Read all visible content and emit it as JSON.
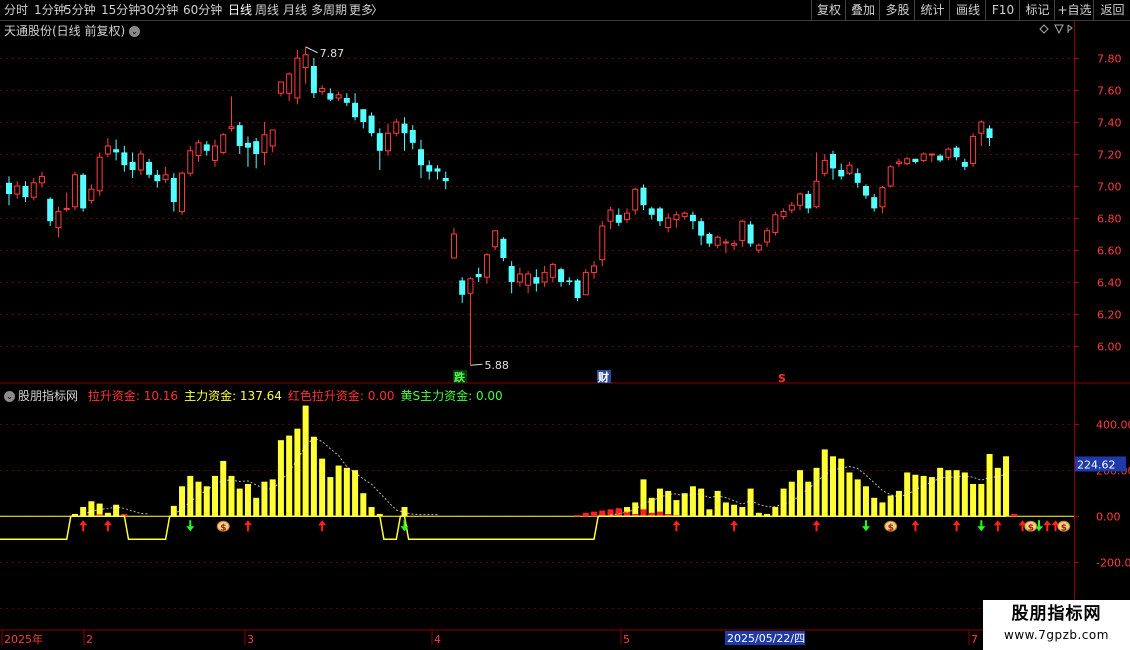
{
  "toolbar": {
    "left": [
      "分时",
      "1分钟",
      "5分钟",
      "15分钟",
      "30分钟",
      "60分钟",
      "日线",
      "周线",
      "月线",
      "多周期",
      "更多"
    ],
    "more_arrow": "〉",
    "right": [
      "复权",
      "叠加",
      "多股",
      "统计",
      "画线",
      "F10",
      "标记",
      "+自选",
      "返回"
    ]
  },
  "stock_title": "天通股份(日线 前复权)",
  "indicator": {
    "name": "股朋指标网",
    "items": [
      {
        "label": "拉升资金:",
        "value": "10.16",
        "color": "#ff3030"
      },
      {
        "label": "主力资金:",
        "value": "137.64",
        "color": "#ffff40"
      },
      {
        "label": "红色拉升资金:",
        "value": "0.00",
        "color": "#ff3030"
      },
      {
        "label": "黄S主力资金:",
        "value": "0.00",
        "color": "#40ff40"
      }
    ]
  },
  "price_axis": [
    "7.80",
    "7.60",
    "7.40",
    "7.20",
    "7.00",
    "6.80",
    "6.60",
    "6.40",
    "6.20",
    "6.00"
  ],
  "indicator_axis": [
    "400.00",
    "200.00",
    "0.00",
    "-200.0",
    "-400.0"
  ],
  "indicator_current": "224.62",
  "price_annotations": {
    "high": "7.87",
    "low": "5.88"
  },
  "markers": {
    "die": "跌",
    "cai": "财",
    "s": "S"
  },
  "date_axis": [
    "2025年",
    "2",
    "3",
    "4",
    "5",
    "6",
    "7"
  ],
  "date_cursor": "2025/05/22/四",
  "watermark": {
    "title": "股朋指标网",
    "url": "www.7gpzb.com"
  },
  "colors": {
    "up": "#ff3c3c",
    "down": "#54ffff",
    "background": "#000000",
    "volume": "#ffff33",
    "grid": "#8b0000"
  },
  "chart_data": {
    "type": "candlestick",
    "ylim": [
      5.85,
      7.95
    ],
    "candles": [
      [
        7.02,
        6.95,
        7.06,
        6.88
      ],
      [
        6.95,
        7.0,
        7.03,
        6.92
      ],
      [
        7.0,
        6.93,
        7.03,
        6.9
      ],
      [
        6.93,
        7.02,
        7.05,
        6.91
      ],
      [
        7.02,
        7.06,
        7.09,
        6.99
      ],
      [
        6.92,
        6.78,
        6.93,
        6.75
      ],
      [
        6.74,
        6.84,
        6.87,
        6.68
      ],
      [
        6.86,
        6.86,
        6.96,
        6.84
      ],
      [
        6.87,
        7.07,
        7.09,
        6.85
      ],
      [
        7.07,
        6.86,
        7.08,
        6.84
      ],
      [
        6.91,
        6.98,
        7.01,
        6.89
      ],
      [
        6.97,
        7.18,
        7.21,
        6.94
      ],
      [
        7.2,
        7.25,
        7.3,
        7.18
      ],
      [
        7.23,
        7.21,
        7.29,
        7.16
      ],
      [
        7.21,
        7.13,
        7.25,
        7.09
      ],
      [
        7.15,
        7.1,
        7.21,
        7.05
      ],
      [
        7.1,
        7.2,
        7.22,
        7.07
      ],
      [
        7.15,
        7.07,
        7.17,
        7.05
      ],
      [
        7.07,
        7.03,
        7.1,
        6.99
      ],
      [
        7.04,
        7.07,
        7.12,
        7.02
      ],
      [
        7.05,
        6.9,
        7.08,
        6.84
      ],
      [
        6.84,
        7.08,
        7.09,
        6.82
      ],
      [
        7.08,
        7.22,
        7.25,
        7.06
      ],
      [
        7.19,
        7.27,
        7.29,
        7.15
      ],
      [
        7.26,
        7.22,
        7.28,
        7.19
      ],
      [
        7.16,
        7.25,
        7.29,
        7.12
      ],
      [
        7.21,
        7.32,
        7.33,
        7.2
      ],
      [
        7.36,
        7.37,
        7.56,
        7.34
      ],
      [
        7.38,
        7.25,
        7.4,
        7.2
      ],
      [
        7.27,
        7.24,
        7.31,
        7.12
      ],
      [
        7.28,
        7.2,
        7.3,
        7.11
      ],
      [
        7.21,
        7.32,
        7.4,
        7.13
      ],
      [
        7.25,
        7.35,
        7.35,
        7.21
      ],
      [
        7.58,
        7.65,
        7.65,
        7.56
      ],
      [
        7.58,
        7.7,
        7.71,
        7.53
      ],
      [
        7.55,
        7.8,
        7.85,
        7.51
      ],
      [
        7.74,
        7.82,
        7.87,
        7.64
      ],
      [
        7.75,
        7.58,
        7.8,
        7.55
      ],
      [
        7.59,
        7.61,
        7.63,
        7.57
      ],
      [
        7.58,
        7.54,
        7.61,
        7.53
      ],
      [
        7.55,
        7.57,
        7.59,
        7.53
      ],
      [
        7.55,
        7.52,
        7.58,
        7.5
      ],
      [
        7.52,
        7.43,
        7.58,
        7.41
      ],
      [
        7.48,
        7.4,
        7.47,
        7.36
      ],
      [
        7.44,
        7.33,
        7.46,
        7.31
      ],
      [
        7.33,
        7.22,
        7.36,
        7.1
      ],
      [
        7.22,
        7.33,
        7.39,
        7.19
      ],
      [
        7.33,
        7.4,
        7.42,
        7.31
      ],
      [
        7.39,
        7.33,
        7.43,
        7.22
      ],
      [
        7.35,
        7.27,
        7.38,
        7.23
      ],
      [
        7.23,
        7.13,
        7.29,
        7.05
      ],
      [
        7.13,
        7.09,
        7.16,
        7.04
      ],
      [
        7.11,
        7.09,
        7.13,
        7.04
      ],
      [
        7.05,
        7.03,
        7.09,
        6.98
      ],
      [
        6.55,
        6.7,
        6.74,
        6.55
      ],
      [
        6.41,
        6.32,
        6.43,
        6.27
      ],
      [
        6.33,
        6.42,
        6.43,
        5.88
      ],
      [
        6.45,
        6.43,
        6.49,
        6.4
      ],
      [
        6.43,
        6.57,
        6.58,
        6.39
      ],
      [
        6.62,
        6.72,
        6.72,
        6.6
      ],
      [
        6.67,
        6.55,
        6.68,
        6.53
      ],
      [
        6.5,
        6.4,
        6.53,
        6.33
      ],
      [
        6.4,
        6.45,
        6.49,
        6.37
      ],
      [
        6.38,
        6.45,
        6.47,
        6.33
      ],
      [
        6.43,
        6.39,
        6.48,
        6.34
      ],
      [
        6.4,
        6.46,
        6.5,
        6.37
      ],
      [
        6.43,
        6.51,
        6.52,
        6.4
      ],
      [
        6.48,
        6.4,
        6.49,
        6.37
      ],
      [
        6.41,
        6.4,
        6.43,
        6.38
      ],
      [
        6.41,
        6.3,
        6.42,
        6.28
      ],
      [
        6.32,
        6.46,
        6.48,
        6.32
      ],
      [
        6.46,
        6.5,
        6.53,
        6.42
      ],
      [
        6.54,
        6.75,
        6.78,
        6.5
      ],
      [
        6.78,
        6.85,
        6.87,
        6.73
      ],
      [
        6.82,
        6.77,
        6.86,
        6.75
      ],
      [
        6.79,
        6.83,
        6.86,
        6.77
      ],
      [
        6.85,
        6.98,
        6.99,
        6.82
      ],
      [
        6.99,
        6.88,
        7.01,
        6.85
      ],
      [
        6.86,
        6.82,
        6.87,
        6.79
      ],
      [
        6.86,
        6.78,
        6.87,
        6.75
      ],
      [
        6.74,
        6.8,
        6.83,
        6.71
      ],
      [
        6.79,
        6.82,
        6.84,
        6.74
      ],
      [
        6.81,
        6.83,
        6.84,
        6.79
      ],
      [
        6.82,
        6.78,
        6.84,
        6.73
      ],
      [
        6.78,
        6.69,
        6.8,
        6.63
      ],
      [
        6.7,
        6.64,
        6.71,
        6.62
      ],
      [
        6.63,
        6.68,
        6.69,
        6.61
      ],
      [
        6.65,
        6.65,
        6.67,
        6.58
      ],
      [
        6.63,
        6.64,
        6.66,
        6.6
      ],
      [
        6.66,
        6.78,
        6.79,
        6.62
      ],
      [
        6.76,
        6.64,
        6.78,
        6.62
      ],
      [
        6.6,
        6.63,
        6.64,
        6.58
      ],
      [
        6.65,
        6.72,
        6.74,
        6.62
      ],
      [
        6.71,
        6.82,
        6.84,
        6.69
      ],
      [
        6.81,
        6.84,
        6.86,
        6.79
      ],
      [
        6.85,
        6.88,
        6.9,
        6.83
      ],
      [
        6.88,
        6.95,
        6.96,
        6.85
      ],
      [
        6.95,
        6.86,
        6.97,
        6.83
      ],
      [
        6.87,
        7.03,
        7.21,
        6.86
      ],
      [
        7.08,
        7.16,
        7.2,
        7.06
      ],
      [
        7.2,
        7.11,
        7.22,
        7.04
      ],
      [
        7.1,
        7.06,
        7.14,
        7.04
      ],
      [
        7.08,
        7.13,
        7.15,
        7.07
      ],
      [
        7.08,
        7.02,
        7.11,
        6.99
      ],
      [
        7.0,
        6.94,
        7.01,
        6.92
      ],
      [
        6.93,
        6.86,
        6.95,
        6.84
      ],
      [
        6.87,
        6.99,
        7.0,
        6.83
      ],
      [
        7.0,
        7.12,
        7.13,
        6.99
      ],
      [
        7.14,
        7.15,
        7.17,
        7.12
      ],
      [
        7.14,
        7.17,
        7.18,
        7.13
      ],
      [
        7.17,
        7.15,
        7.17,
        7.14
      ],
      [
        7.16,
        7.2,
        7.21,
        7.15
      ],
      [
        7.2,
        7.2,
        7.2,
        7.15
      ],
      [
        7.19,
        7.16,
        7.2,
        7.15
      ],
      [
        7.18,
        7.23,
        7.24,
        7.16
      ],
      [
        7.24,
        7.18,
        7.25,
        7.16
      ],
      [
        7.15,
        7.12,
        7.17,
        7.1
      ],
      [
        7.14,
        7.31,
        7.33,
        7.12
      ],
      [
        7.33,
        7.4,
        7.41,
        7.25
      ],
      [
        7.36,
        7.3,
        7.38,
        7.25
      ]
    ],
    "indicator": {
      "ylim": [
        -450,
        500
      ],
      "main_force": [
        0,
        0,
        0,
        0,
        0,
        0,
        0,
        0,
        10,
        40,
        65,
        55,
        15,
        50,
        5,
        0,
        0,
        0,
        0,
        0,
        45,
        130,
        175,
        150,
        130,
        175,
        240,
        175,
        120,
        140,
        80,
        150,
        160,
        330,
        350,
        380,
        480,
        345,
        250,
        170,
        220,
        210,
        200,
        100,
        40,
        10,
        0,
        0,
        40,
        0,
        0,
        0,
        0,
        0,
        0,
        0,
        0,
        0,
        0,
        0,
        0,
        0,
        0,
        0,
        0,
        0,
        0,
        0,
        0,
        0,
        0,
        0,
        10,
        20,
        30,
        40,
        60,
        160,
        80,
        120,
        110,
        70,
        100,
        130,
        120,
        30,
        110,
        60,
        50,
        40,
        120,
        15,
        10,
        40,
        120,
        150,
        200,
        150,
        210,
        290,
        260,
        250,
        190,
        160,
        130,
        80,
        60,
        90,
        110,
        190,
        180,
        175,
        170,
        210,
        200,
        200,
        190,
        140,
        140,
        270,
        210,
        260
      ],
      "lift": [
        0,
        0,
        0,
        0,
        0,
        0,
        0,
        0,
        0,
        0,
        0,
        8,
        0,
        0,
        10,
        0,
        0,
        0,
        0,
        0,
        0,
        0,
        0,
        0,
        0,
        0,
        0,
        0,
        0,
        0,
        0,
        0,
        0,
        0,
        0,
        0,
        0,
        0,
        0,
        0,
        0,
        0,
        0,
        0,
        0,
        0,
        0,
        0,
        0,
        0,
        0,
        0,
        0,
        0,
        0,
        0,
        0,
        0,
        0,
        0,
        0,
        0,
        0,
        0,
        0,
        0,
        0,
        0,
        0,
        5,
        15,
        20,
        25,
        30,
        35,
        20,
        10,
        30,
        15,
        20,
        10,
        5,
        0,
        0,
        0,
        0,
        0,
        0,
        0,
        0,
        0,
        0,
        0,
        0,
        0,
        0,
        0,
        0,
        0,
        0,
        0,
        0,
        0,
        0,
        0,
        0,
        0,
        0,
        0,
        0,
        0,
        0,
        0,
        0,
        0,
        0,
        0,
        0,
        0,
        0,
        0,
        0,
        10
      ],
      "up_arrows": [
        9,
        12,
        29,
        38,
        81,
        88,
        98,
        110,
        115,
        120,
        123,
        126,
        127
      ],
      "down_arrows": [
        22,
        48,
        104,
        118,
        125
      ],
      "money_bags": [
        26,
        107,
        124,
        128
      ]
    }
  }
}
